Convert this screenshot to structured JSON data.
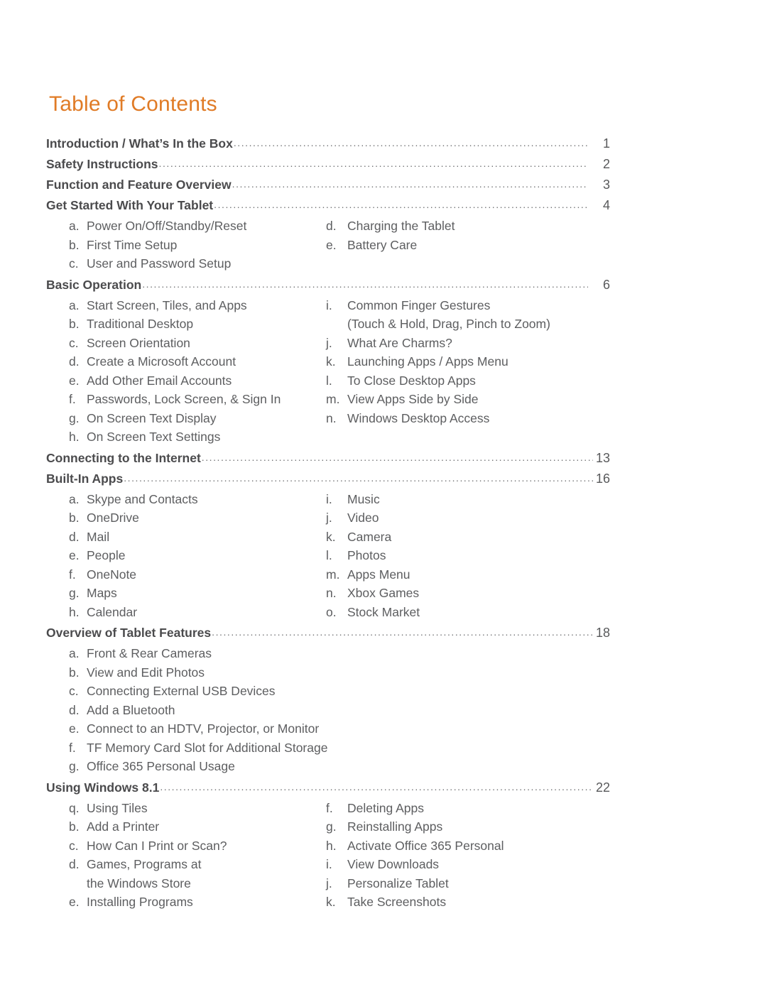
{
  "document": {
    "title": "Table of Contents",
    "title_color": "#e07b26",
    "heading_color": "#4b4b4d",
    "subitem_color": "#5d5e60"
  },
  "sections": [
    {
      "heading": "Introduction / What’s In the Box",
      "page": "1",
      "left": [],
      "right": []
    },
    {
      "heading": "Safety Instructions",
      "page": "2",
      "left": [],
      "right": []
    },
    {
      "heading": "Function and Feature Overview",
      "page": "3",
      "left": [],
      "right": []
    },
    {
      "heading": "Get Started With Your Tablet",
      "page": "4",
      "left": [
        {
          "marker": "a.",
          "text": "Power On/Off/Standby/Reset"
        },
        {
          "marker": "b.",
          "text": "First Time Setup"
        },
        {
          "marker": "c.",
          "text": "User and Password Setup"
        }
      ],
      "right": [
        {
          "marker": "d.",
          "text": "Charging the Tablet"
        },
        {
          "marker": "e.",
          "text": "Battery Care"
        }
      ]
    },
    {
      "heading": "Basic Operation",
      "page": "6",
      "left": [
        {
          "marker": "a.",
          "text": "Start Screen, Tiles, and Apps"
        },
        {
          "marker": "b.",
          "text": "Traditional Desktop"
        },
        {
          "marker": "c.",
          "text": "Screen Orientation"
        },
        {
          "marker": "d.",
          "text": "Create a Microsoft Account"
        },
        {
          "marker": "e.",
          "text": "Add Other Email Accounts"
        },
        {
          "marker": "f.",
          "text": "Passwords, Lock Screen, & Sign In"
        },
        {
          "marker": "g.",
          "text": "On Screen Text Display"
        },
        {
          "marker": "h.",
          "text": "On Screen Text Settings"
        }
      ],
      "right": [
        {
          "marker": "i.",
          "text": "Common Finger Gestures"
        },
        {
          "marker": "",
          "text": "(Touch & Hold, Drag, Pinch to Zoom)",
          "continuation": true
        },
        {
          "marker": "j.",
          "text": "What Are Charms?"
        },
        {
          "marker": "k.",
          "text": "Launching Apps / Apps Menu"
        },
        {
          "marker": "l.",
          "text": "To Close Desktop Apps"
        },
        {
          "marker": "m.",
          "text": "View Apps Side by Side"
        },
        {
          "marker": "n.",
          "text": "Windows Desktop Access"
        }
      ]
    },
    {
      "heading": "Connecting to the Internet",
      "page": "13",
      "left": [],
      "right": []
    },
    {
      "heading": "Built-In Apps",
      "page": "16",
      "left": [
        {
          "marker": "a.",
          "text": "Skype and Contacts"
        },
        {
          "marker": "b.",
          "text": "OneDrive"
        },
        {
          "marker": "d.",
          "text": "Mail"
        },
        {
          "marker": "e.",
          "text": "People"
        },
        {
          "marker": "f.",
          "text": "OneNote"
        },
        {
          "marker": "g.",
          "text": "Maps"
        },
        {
          "marker": "h.",
          "text": "Calendar"
        }
      ],
      "right": [
        {
          "marker": "i.",
          "text": "Music"
        },
        {
          "marker": "j.",
          "text": "Video"
        },
        {
          "marker": "k.",
          "text": "Camera"
        },
        {
          "marker": "l.",
          "text": "Photos"
        },
        {
          "marker": "m.",
          "text": "Apps Menu"
        },
        {
          "marker": "n.",
          "text": "Xbox Games"
        },
        {
          "marker": "o.",
          "text": "Stock Market"
        }
      ]
    },
    {
      "heading": "Overview of Tablet Features",
      "page": "18",
      "left": [
        {
          "marker": "a.",
          "text": "Front & Rear Cameras"
        },
        {
          "marker": "b.",
          "text": "View and Edit Photos"
        },
        {
          "marker": "c.",
          "text": "Connecting External USB Devices"
        },
        {
          "marker": "d.",
          "text": "Add a Bluetooth"
        },
        {
          "marker": "e.",
          "text": "Connect to an HDTV, Projector, or Monitor"
        },
        {
          "marker": "f.",
          "text": "TF Memory Card Slot for Additional Storage"
        },
        {
          "marker": "g.",
          "text": "Office 365 Personal Usage"
        }
      ],
      "right": []
    },
    {
      "heading": "Using Windows 8.1",
      "page": "22",
      "left": [
        {
          "marker": "q.",
          "text": "Using Tiles"
        },
        {
          "marker": "b.",
          "text": "Add a Printer"
        },
        {
          "marker": "c.",
          "text": "How Can I Print or Scan?"
        },
        {
          "marker": "d.",
          "text": "Games, Programs at"
        },
        {
          "marker": "",
          "text": "the Windows Store",
          "continuation": true
        },
        {
          "marker": "e.",
          "text": "Installing Programs"
        }
      ],
      "right": [
        {
          "marker": "f.",
          "text": "Deleting Apps"
        },
        {
          "marker": "g.",
          "text": "Reinstalling Apps"
        },
        {
          "marker": "h.",
          "text": "Activate Office 365 Personal"
        },
        {
          "marker": "i.",
          "text": "View Downloads"
        },
        {
          "marker": "j.",
          "text": "Personalize Tablet"
        },
        {
          "marker": "k.",
          "text": "Take Screenshots"
        }
      ]
    }
  ]
}
